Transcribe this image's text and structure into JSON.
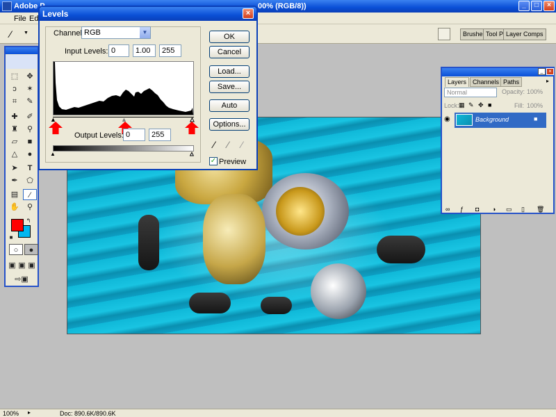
{
  "app": {
    "title": "Adobe P",
    "title_right": "00% (RGB/8))"
  },
  "menu": {
    "items": [
      "File",
      "Edi"
    ]
  },
  "palette_well": {
    "tabs": [
      "Brushes",
      "Tool Pr",
      "Layer Comps"
    ]
  },
  "levels": {
    "title": "Levels",
    "channel_label": "Channel:",
    "channel_value": "RGB",
    "input_levels_label": "Input Levels:",
    "input_black": "0",
    "input_gamma": "1.00",
    "input_white": "255",
    "output_levels_label": "Output Levels:",
    "output_black": "0",
    "output_white": "255",
    "buttons": {
      "ok": "OK",
      "cancel": "Cancel",
      "load": "Load...",
      "save": "Save...",
      "auto": "Auto",
      "options": "Options..."
    },
    "preview_label": "Preview",
    "preview_checked": true
  },
  "layers": {
    "tabs": [
      "Layers",
      "Channels",
      "Paths"
    ],
    "blend_mode": "Normal",
    "opacity_label": "Opacity:",
    "opacity_value": "100%",
    "lock_label": "Lock:",
    "fill_label": "Fill:",
    "fill_value": "100%",
    "layer_name": "Background"
  },
  "status": {
    "zoom": "100%",
    "doc": "Doc: 890.6K/890.6K"
  },
  "colors": {
    "foreground": "#ff0000",
    "background": "#00b7ef",
    "accent": "#0a4fd6"
  }
}
